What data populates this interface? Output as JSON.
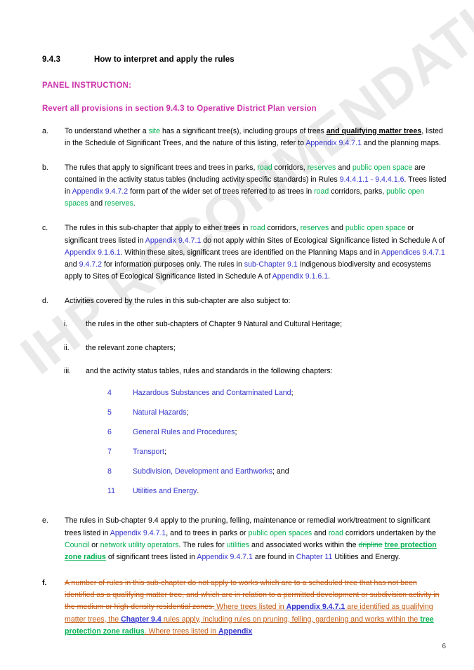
{
  "document": {
    "watermark_text": "IHP RECOMMENDATIONS",
    "page_number": "6"
  },
  "colors": {
    "defined_term_green": "#00B050",
    "cross_reference_blue": "#3333CC",
    "panel_magenta": "#CC33AA",
    "amendment_orange": "#C55A11"
  },
  "heading": {
    "number": "9.4.3",
    "title": "How to interpret and apply the rules"
  },
  "panel": {
    "label": "PANEL INSTRUCTION:",
    "instruction": "Revert all provisions in section 9.4.3 to Operative District Plan version"
  },
  "clauses": {
    "a": {
      "marker": "a.",
      "t1": "To understand whether a ",
      "t2": "site",
      "t3": " has a significant tree(s), including groups of trees ",
      "t4": "and qualifying matter trees",
      "t5": ", listed in the Schedule of Significant Trees, and the nature of this listing, refer to ",
      "t6": "Appendix 9.4.7.1",
      "t7": " and the planning maps."
    },
    "b": {
      "marker": "b.",
      "t1": "The rules that apply to significant trees and trees in parks, ",
      "t2": "road",
      "t3": " corridors, ",
      "t4": "reserves",
      "t5": " and ",
      "t6": "public open space",
      "t7": " are contained in the activity status tables (including activity specific standards) in Rules ",
      "t8": "9.4.4.1.1 - 9.4.4.1.6",
      "t9": ". Trees listed in ",
      "t10": "Appendix 9.4.7.2",
      "t11": " form part of the wider set of trees referred to as trees in ",
      "t12": "road",
      "t13": " corridors, parks, ",
      "t14": "public open spaces",
      "t15": " and ",
      "t16": "reserves",
      "t17": "."
    },
    "c": {
      "marker": "c.",
      "t1": "The rules in this sub-chapter that apply to either trees in ",
      "t2": "road",
      "t3": " corridors, ",
      "t4": "reserves",
      "t5": " and ",
      "t6": "public open space",
      "t7": " or significant trees listed in ",
      "t8": "Appendix 9.4.7.1",
      "t9": " do not apply within Sites of Ecological Significance listed in Schedule A of ",
      "t10": "Appendix 9.1.6.1",
      "t11": ". Within these sites, significant trees are identified on the Planning Maps and in ",
      "t12": "Appendices 9.4.7.1",
      "t13": " and ",
      "t14": "9.4.7.2",
      "t15": " for information purposes only. The rules in ",
      "t16": "sub-Chapter 9.1",
      "t17": " Indigenous biodiversity and ecosystems apply to Sites of Ecological Significance listed in Schedule A of ",
      "t18": "Appendix 9.1.6.1",
      "t19": "."
    },
    "d": {
      "marker": "d.",
      "text": "Activities covered by the rules in this sub-chapter are also subject to:",
      "sub": [
        {
          "marker": "i.",
          "text": "the rules in the other sub-chapters of Chapter 9 Natural and Cultural Heritage;"
        },
        {
          "marker": "ii.",
          "text": "the relevant zone chapters;"
        },
        {
          "marker": "iii.",
          "text": "and the activity status tables, rules and standards in the following chapters:"
        }
      ],
      "chapters": [
        {
          "number": "4",
          "title": "Hazardous Substances and Contaminated Land",
          "suffix": ";"
        },
        {
          "number": "5",
          "title": "Natural Hazards",
          "suffix": ";"
        },
        {
          "number": "6",
          "title": "General Rules and Procedures",
          "suffix": ";"
        },
        {
          "number": "7",
          "title": "Transport",
          "suffix": ";"
        },
        {
          "number": "8",
          "title": "Subdivision, Development and Earthworks",
          "suffix": "; and"
        },
        {
          "number": "11",
          "title": "Utilities and Energy",
          "suffix": "."
        }
      ]
    },
    "e": {
      "marker": "e.",
      "t1": "The rules in Sub-chapter 9.4 apply to the pruning, felling, maintenance or remedial work/treatment to significant trees listed in ",
      "t2": "Appendix 9.4.7.1",
      "t3": ", and to trees in parks or ",
      "t4": "public open spaces",
      "t5": " and ",
      "t6": "road",
      "t7": " corridors undertaken by the ",
      "t8": "Council",
      "t9": " or ",
      "t10": "network utility operators",
      "t11": ".  The rules for ",
      "t12": "utilities",
      "t13": " and associated works within the ",
      "t14": "dripline",
      "t15": " ",
      "t16": "tree protection zone radius",
      "t17": " of significant trees listed in ",
      "t18": "Appendix 9.4.7.1",
      "t19": " are found in ",
      "t20": "Chapter 11",
      "t21": " Utilities and Energy."
    },
    "f": {
      "marker": "f.",
      "t1": "A number of rules in this sub-chapter do not apply to works which are to a scheduled tree that has not been identified as a qualifying matter tree, and which are in relation to a permitted development or subdivision activity in the medium or high-density residential zones.",
      "t2": " Where trees listed in ",
      "t3": "Appendix 9.4.7.1",
      "t4": " are identified as qualifying matter trees, the ",
      "t5": "Chapter 9.4",
      "t6": " rules apply, including rules on pruning, felling, gardening and works within the ",
      "t7": "tree protection zone radius",
      "t8": ". Where trees listed in ",
      "t9": "Appendix"
    }
  }
}
